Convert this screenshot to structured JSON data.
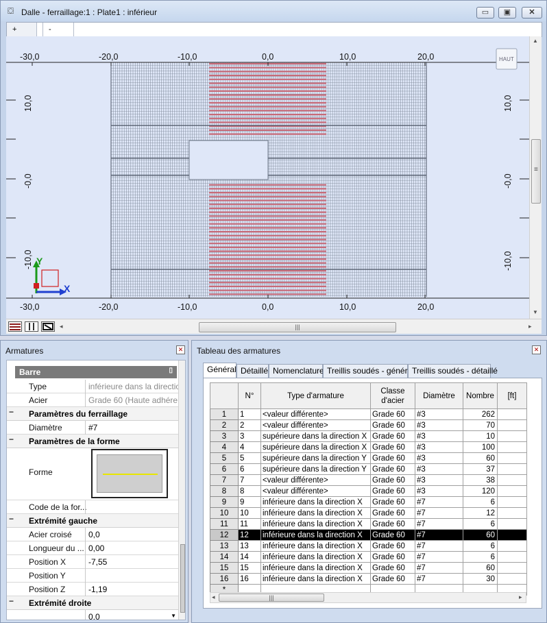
{
  "window": {
    "title": "Dalle - ferraillage:1 : Plate1  : inférieur",
    "minimize": "▭",
    "maximize": "▣",
    "close": "✕"
  },
  "view_tabs": [
    "+",
    "-"
  ],
  "view_cube_label": "HAUT",
  "axes": {
    "x_top_ticks": [
      "-30,0",
      "-20,0",
      "-10,0",
      "0,0",
      "10,0",
      "20,0"
    ],
    "x_bottom_ticks": [
      "-30,0",
      "-20,0",
      "-10,0",
      "0,0",
      "10,0",
      "20,0"
    ],
    "y_left_ticks": [
      "10,0",
      "-0,0",
      "-10,0"
    ],
    "y_right_ticks": [
      "10,0",
      "-0,0",
      "-10,0"
    ],
    "ucs_x": "X",
    "ucs_y": "Y"
  },
  "colors": {
    "rebar_grey": "#6f7a8a",
    "rebar_red": "#c76a78",
    "canvas_bg": "#dfe7f8",
    "selection": "#000000"
  },
  "armatures_panel": {
    "title": "Armatures",
    "category": "Barre",
    "rows": [
      {
        "name": "Type",
        "value": "inférieure dans la directio..."
      },
      {
        "name": "Acier",
        "value": "Grade 60 (Haute adhére..."
      }
    ],
    "section_parametres_ferraillage": "Paramètres du ferraillage",
    "diametre_label": "Diamètre",
    "diametre_value": "#7",
    "section_parametres_forme": "Paramètres de la forme",
    "forme_label": "Forme",
    "code_forme_label": "Code de la for...",
    "section_extremite_gauche": "Extrémité gauche",
    "acier_croise_label": "Acier croisé",
    "acier_croise_value": "0,0",
    "longueur_label": "Longueur du ...",
    "longueur_value": "0,00",
    "position_x_label": "Position X",
    "position_x_value": "-7,55",
    "position_y_label": "Position Y",
    "position_y_value": "",
    "position_z_label": "Position Z",
    "position_z_value": "-1,19",
    "section_extremite_droite": "Extrémité droite",
    "dropdown_value": "0,0"
  },
  "table_panel": {
    "title": "Tableau des armatures",
    "tabs": [
      "Général",
      "Détaillé",
      "Nomenclature",
      "Treillis soudés - général",
      "Treillis soudés - détaillé"
    ],
    "columns": [
      "N°",
      "Type d'armature",
      "Classe d'acier",
      "Diamètre",
      "Nombre",
      "[ft]"
    ],
    "selected_row": 12,
    "rows": [
      {
        "row": "1",
        "n": "1",
        "type": "<valeur différente>",
        "classe": "Grade 60",
        "diam": "#3",
        "nombre": "262"
      },
      {
        "row": "2",
        "n": "2",
        "type": "<valeur différente>",
        "classe": "Grade 60",
        "diam": "#3",
        "nombre": "70"
      },
      {
        "row": "3",
        "n": "3",
        "type": "supérieure dans la direction X",
        "classe": "Grade 60",
        "diam": "#3",
        "nombre": "10"
      },
      {
        "row": "4",
        "n": "4",
        "type": "supérieure dans la direction X",
        "classe": "Grade 60",
        "diam": "#3",
        "nombre": "100"
      },
      {
        "row": "5",
        "n": "5",
        "type": "supérieure dans la direction Y",
        "classe": "Grade 60",
        "diam": "#3",
        "nombre": "60"
      },
      {
        "row": "6",
        "n": "6",
        "type": "supérieure dans la direction Y",
        "classe": "Grade 60",
        "diam": "#3",
        "nombre": "37"
      },
      {
        "row": "7",
        "n": "7",
        "type": "<valeur différente>",
        "classe": "Grade 60",
        "diam": "#3",
        "nombre": "38"
      },
      {
        "row": "8",
        "n": "8",
        "type": "<valeur différente>",
        "classe": "Grade 60",
        "diam": "#3",
        "nombre": "120"
      },
      {
        "row": "9",
        "n": "9",
        "type": "inférieure dans la direction X",
        "classe": "Grade 60",
        "diam": "#7",
        "nombre": "6"
      },
      {
        "row": "10",
        "n": "10",
        "type": "inférieure dans la direction X",
        "classe": "Grade 60",
        "diam": "#7",
        "nombre": "12"
      },
      {
        "row": "11",
        "n": "11",
        "type": "inférieure dans la direction X",
        "classe": "Grade 60",
        "diam": "#7",
        "nombre": "6"
      },
      {
        "row": "12",
        "n": "12",
        "type": "inférieure dans la direction X",
        "classe": "Grade 60",
        "diam": "#7",
        "nombre": "60"
      },
      {
        "row": "13",
        "n": "13",
        "type": "inférieure dans la direction X",
        "classe": "Grade 60",
        "diam": "#7",
        "nombre": "6"
      },
      {
        "row": "14",
        "n": "14",
        "type": "inférieure dans la direction X",
        "classe": "Grade 60",
        "diam": "#7",
        "nombre": "6"
      },
      {
        "row": "15",
        "n": "15",
        "type": "inférieure dans la direction X",
        "classe": "Grade 60",
        "diam": "#7",
        "nombre": "60"
      },
      {
        "row": "16",
        "n": "16",
        "type": "inférieure dans la direction X",
        "classe": "Grade 60",
        "diam": "#7",
        "nombre": "30"
      }
    ],
    "new_row_marker": "*"
  }
}
